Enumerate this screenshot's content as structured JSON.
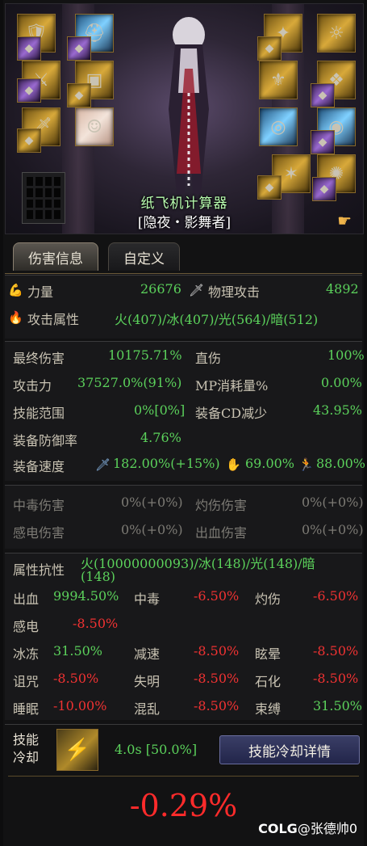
{
  "character": {
    "name": "纸飞机计算器",
    "class": "[隐夜・影舞者]",
    "colors": {
      "name": "#b9ffb0",
      "class": "#ffffff"
    }
  },
  "tabs": [
    {
      "label": "伤害信息",
      "active": true
    },
    {
      "label": "自定义",
      "active": false
    }
  ],
  "stats": {
    "strength_label": "力量",
    "strength_value": "26676",
    "phys_atk_label": "物理攻击",
    "phys_atk_value": "4892",
    "attr_label": "攻击属性",
    "attr_value": "火(407)/冰(407)/光(564)/暗(512)",
    "final_dmg_label": "最终伤害",
    "final_dmg_value": "10175.71%",
    "direct_label": "直伤",
    "direct_value": "100%",
    "atk_power_label": "攻击力",
    "atk_power_value": "37527.0%(91%)",
    "mp_label": "MP消耗量%",
    "mp_value": "0.00%",
    "skill_range_label": "技能范围",
    "skill_range_value": "0%[0%]",
    "cd_reduce_label": "装备CD减少",
    "cd_reduce_value": "43.95%",
    "def_rate_label": "装备防御率",
    "def_rate_value": "4.76%",
    "speed_label": "装备速度",
    "speed_1": "182.00%(+15%)",
    "speed_2": "69.00%",
    "speed_3": "88.00%"
  },
  "dot": {
    "poison_label": "中毒伤害",
    "poison_value": "0%(+0%)",
    "burn_label": "灼伤伤害",
    "burn_value": "0%(+0%)",
    "shock_label": "感电伤害",
    "shock_value": "0%(+0%)",
    "bleed_label": "出血伤害",
    "bleed_value": "0%(+0%)"
  },
  "resist": {
    "label": "属性抗性",
    "value_line1": "火(10000000093)/冰(148)/光(148)/暗",
    "value_line2": "(148)",
    "items": [
      {
        "label": "出血",
        "value": "9994.50%",
        "color": "green"
      },
      {
        "label": "中毒",
        "value": "-6.50%",
        "color": "red"
      },
      {
        "label": "灼伤",
        "value": "-6.50%",
        "color": "red"
      },
      {
        "label": "感电",
        "value": "-8.50%",
        "color": "red"
      },
      {
        "label": "冰冻",
        "value": "31.50%",
        "color": "green"
      },
      {
        "label": "减速",
        "value": "-8.50%",
        "color": "red"
      },
      {
        "label": "眩晕",
        "value": "-8.50%",
        "color": "red"
      },
      {
        "label": "诅咒",
        "value": "-8.50%",
        "color": "red"
      },
      {
        "label": "失明",
        "value": "-8.50%",
        "color": "red"
      },
      {
        "label": "石化",
        "value": "-8.50%",
        "color": "red"
      },
      {
        "label": "睡眠",
        "value": "-10.00%",
        "color": "red"
      },
      {
        "label": "混乱",
        "value": "-8.50%",
        "color": "red"
      },
      {
        "label": "束缚",
        "value": "31.50%",
        "color": "green"
      }
    ]
  },
  "cooldown": {
    "label_line1": "技能",
    "label_line2": "冷却",
    "value": "4.0s [50.0%]",
    "button": "技能冷却详情"
  },
  "total": "-0.29%",
  "watermark": {
    "brand": "COLG",
    "user": "@张德帅0"
  },
  "colors": {
    "green": "#5bd15b",
    "red": "#f03232",
    "gray": "#7c7a74",
    "label": "#c9c3b3"
  }
}
